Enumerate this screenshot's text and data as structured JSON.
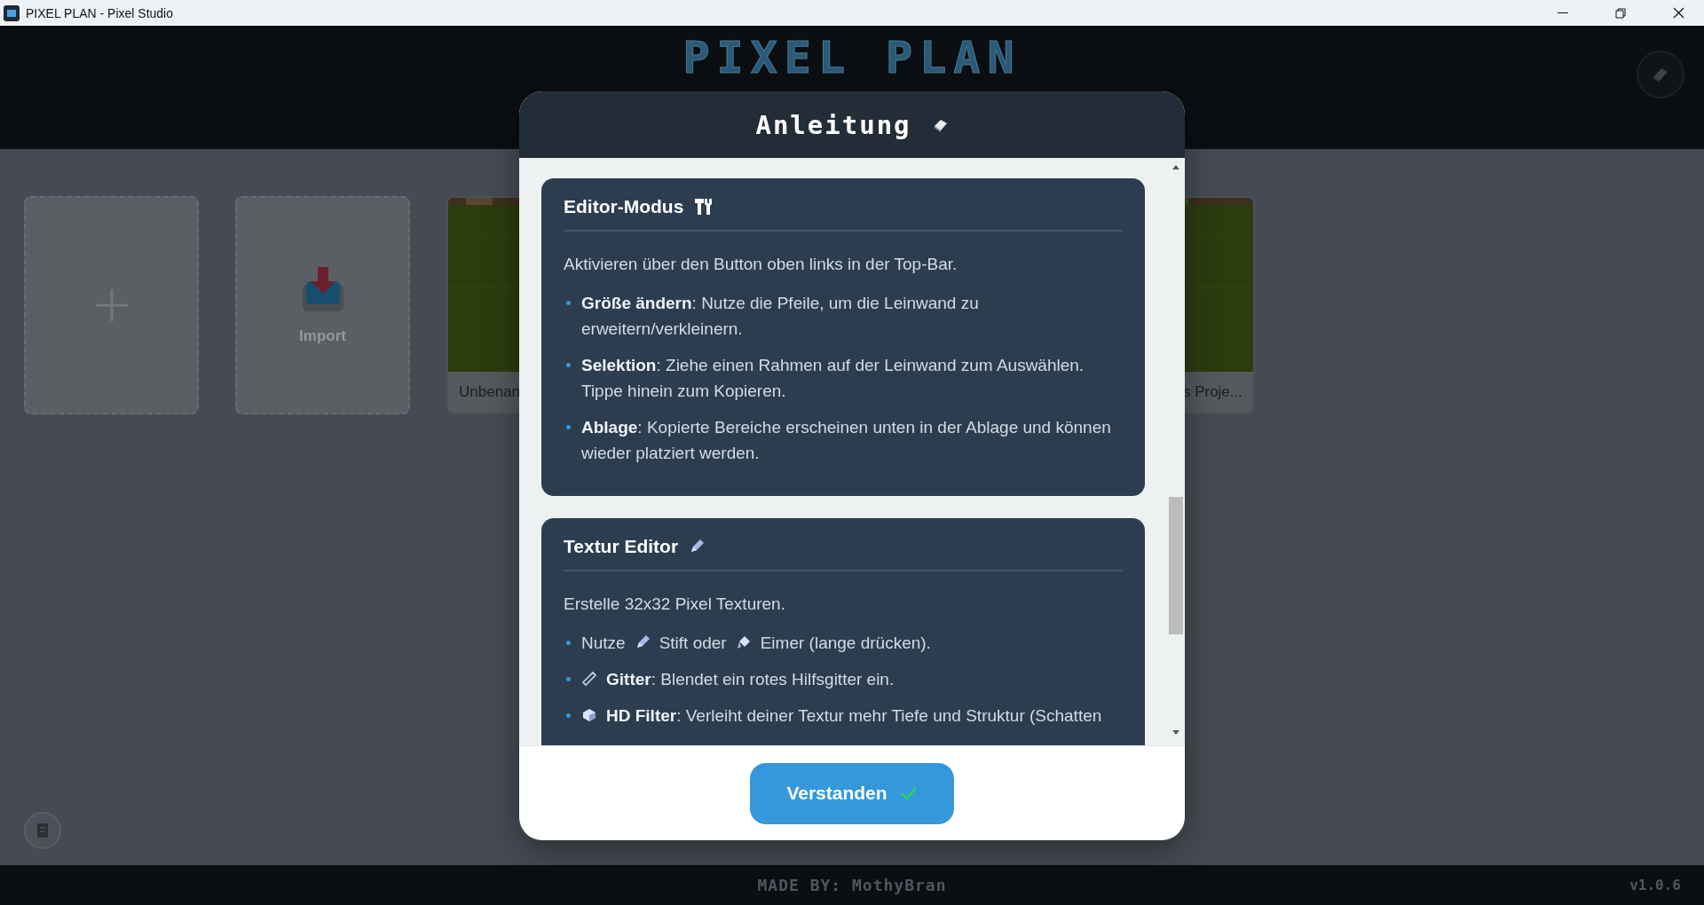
{
  "window": {
    "title": "PIXEL PLAN - Pixel Studio"
  },
  "header": {
    "logo": "PIXEL PLAN"
  },
  "tiles": [
    {
      "kind": "new"
    },
    {
      "kind": "import",
      "label": "Import"
    },
    {
      "kind": "project",
      "name": "Unbenan"
    },
    {
      "kind": "hidden"
    },
    {
      "kind": "hidden"
    },
    {
      "kind": "project-end",
      "name": "s Proje..."
    }
  ],
  "modal": {
    "title": "Anleitung",
    "sections": [
      {
        "title": "Editor-Modus",
        "kind": "tools",
        "intro": "Aktivieren über den Button oben links in der Top-Bar.",
        "items": [
          {
            "segments": [
              {
                "kind": "text",
                "text": "**Größe ändern**: Nutze die Pfeile, um die Leinwand zu erweitern/verkleinern."
              }
            ]
          },
          {
            "segments": [
              {
                "kind": "text",
                "text": "**Selektion**: Ziehe einen Rahmen auf der Leinwand zum Auswählen. Tippe hinein zum Kopieren."
              }
            ]
          },
          {
            "segments": [
              {
                "kind": "text",
                "text": "**Ablage**: Kopierte Bereiche erscheinen unten in der Ablage und können wieder platziert werden."
              }
            ]
          }
        ]
      },
      {
        "title": "Textur Editor",
        "kind": "pencil",
        "intro": "Erstelle 32x32 Pixel Texturen.",
        "items": [
          {
            "segments": [
              {
                "kind": "text",
                "text": "Nutze"
              },
              {
                "kind": "pencil"
              },
              {
                "kind": "text",
                "text": "Stift oder"
              },
              {
                "kind": "bucket"
              },
              {
                "kind": "text",
                "text": "Eimer (lange drücken)."
              }
            ]
          },
          {
            "segments": [
              {
                "kind": "ruler"
              },
              {
                "kind": "text",
                "text": "**Gitter**: Blendet ein rotes Hilfsgitter ein."
              }
            ]
          },
          {
            "segments": [
              {
                "kind": "cube"
              },
              {
                "kind": "clipped",
                "text": "**HD Filter**: Verleiht deiner Textur mehr Tiefe und Struktur (Schatten"
              }
            ]
          }
        ]
      }
    ],
    "button": "Verstanden"
  },
  "footer": {
    "credit": "MADE BY: MothyBran",
    "version": "v1.0.6"
  }
}
